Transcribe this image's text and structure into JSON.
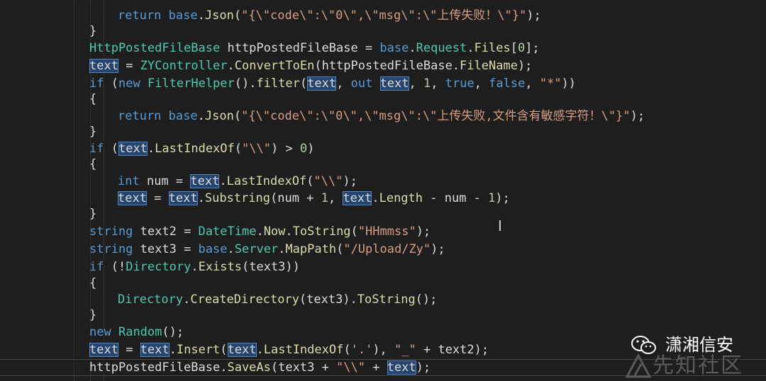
{
  "editor": {
    "lines": [
      [
        [
          "kw",
          "return"
        ],
        [
          "id",
          " "
        ],
        [
          "kw",
          "base"
        ],
        [
          "id",
          "."
        ],
        [
          "me",
          "Json"
        ],
        [
          "id",
          "("
        ],
        [
          "st",
          "\"{\\\"code\\\":\\\"0\\\",\\\"msg\\\":\\\"上传失败！\\\"}\""
        ],
        [
          "id",
          ");"
        ]
      ],
      [
        [
          "id",
          "}"
        ]
      ],
      [
        [
          "ty",
          "HttpPostedFileBase"
        ],
        [
          "id",
          " httpPostedFileBase = "
        ],
        [
          "kw",
          "base"
        ],
        [
          "id",
          "."
        ],
        [
          "ty",
          "Request"
        ],
        [
          "id",
          "."
        ],
        [
          "me",
          "Files"
        ],
        [
          "id",
          "["
        ],
        [
          "nu",
          "0"
        ],
        [
          "id",
          "];"
        ]
      ],
      [
        [
          "hl",
          "text"
        ],
        [
          "id",
          " = "
        ],
        [
          "ty",
          "ZYController"
        ],
        [
          "id",
          "."
        ],
        [
          "me",
          "ConvertToEn"
        ],
        [
          "id",
          "(httpPostedFileBase."
        ],
        [
          "me",
          "FileName"
        ],
        [
          "id",
          ");"
        ]
      ],
      [
        [
          "kw",
          "if"
        ],
        [
          "id",
          " ("
        ],
        [
          "kw",
          "new"
        ],
        [
          "id",
          " "
        ],
        [
          "ty",
          "FilterHelper"
        ],
        [
          "id",
          "()."
        ],
        [
          "me",
          "filter"
        ],
        [
          "id",
          "("
        ],
        [
          "hl",
          "text"
        ],
        [
          "id",
          ", "
        ],
        [
          "kw",
          "out"
        ],
        [
          "id",
          " "
        ],
        [
          "hl",
          "text"
        ],
        [
          "id",
          ", "
        ],
        [
          "nu",
          "1"
        ],
        [
          "id",
          ", "
        ],
        [
          "kw",
          "true"
        ],
        [
          "id",
          ", "
        ],
        [
          "kw",
          "false"
        ],
        [
          "id",
          ", "
        ],
        [
          "st",
          "\"*\""
        ],
        [
          "id",
          "))"
        ]
      ],
      [
        [
          "id",
          "{"
        ]
      ],
      [
        [
          "kw",
          "return"
        ],
        [
          "id",
          " "
        ],
        [
          "kw",
          "base"
        ],
        [
          "id",
          "."
        ],
        [
          "me",
          "Json"
        ],
        [
          "id",
          "("
        ],
        [
          "st",
          "\"{\\\"code\\\":\\\"0\\\",\\\"msg\\\":\\\"上传失败,文件含有敏感字符！\\\"}\""
        ],
        [
          "id",
          ");"
        ]
      ],
      [
        [
          "id",
          "}"
        ]
      ],
      [
        [
          "kw",
          "if"
        ],
        [
          "id",
          " ("
        ],
        [
          "hl",
          "text"
        ],
        [
          "id",
          "."
        ],
        [
          "me",
          "LastIndexOf"
        ],
        [
          "id",
          "("
        ],
        [
          "st",
          "\"\\\\\""
        ],
        [
          "id",
          ") > "
        ],
        [
          "nu",
          "0"
        ],
        [
          "id",
          ")"
        ]
      ],
      [
        [
          "id",
          "{"
        ]
      ],
      [
        [
          "kw",
          "int"
        ],
        [
          "id",
          " num = "
        ],
        [
          "hl",
          "text"
        ],
        [
          "id",
          "."
        ],
        [
          "me",
          "LastIndexOf"
        ],
        [
          "id",
          "("
        ],
        [
          "st",
          "\"\\\\\""
        ],
        [
          "id",
          ");"
        ]
      ],
      [
        [
          "hl",
          "text"
        ],
        [
          "id",
          " = "
        ],
        [
          "hl",
          "text"
        ],
        [
          "id",
          "."
        ],
        [
          "me",
          "Substring"
        ],
        [
          "id",
          "(num + "
        ],
        [
          "nu",
          "1"
        ],
        [
          "id",
          ", "
        ],
        [
          "hl",
          "text"
        ],
        [
          "id",
          "."
        ],
        [
          "me",
          "Length"
        ],
        [
          "id",
          " - num - "
        ],
        [
          "nu",
          "1"
        ],
        [
          "id",
          ");"
        ]
      ],
      [
        [
          "id",
          "}"
        ]
      ],
      [
        [
          "kw",
          "string"
        ],
        [
          "id",
          " text2 = "
        ],
        [
          "ty",
          "DateTime"
        ],
        [
          "id",
          "."
        ],
        [
          "me",
          "Now"
        ],
        [
          "id",
          "."
        ],
        [
          "me",
          "ToString"
        ],
        [
          "id",
          "("
        ],
        [
          "st",
          "\"HHmmss\""
        ],
        [
          "id",
          ");"
        ]
      ],
      [
        [
          "kw",
          "string"
        ],
        [
          "id",
          " text3 = "
        ],
        [
          "kw",
          "base"
        ],
        [
          "id",
          "."
        ],
        [
          "ty",
          "Server"
        ],
        [
          "id",
          "."
        ],
        [
          "me",
          "MapPath"
        ],
        [
          "id",
          "("
        ],
        [
          "st",
          "\"/Upload/Zy\""
        ],
        [
          "id",
          ");"
        ]
      ],
      [
        [
          "kw",
          "if"
        ],
        [
          "id",
          " (!"
        ],
        [
          "ty",
          "Directory"
        ],
        [
          "id",
          "."
        ],
        [
          "me",
          "Exists"
        ],
        [
          "id",
          "(text3))"
        ]
      ],
      [
        [
          "id",
          "{"
        ]
      ],
      [
        [
          "ty",
          "Directory"
        ],
        [
          "id",
          "."
        ],
        [
          "me",
          "CreateDirectory"
        ],
        [
          "id",
          "(text3)."
        ],
        [
          "me",
          "ToString"
        ],
        [
          "id",
          "();"
        ]
      ],
      [
        [
          "id",
          "}"
        ]
      ],
      [
        [
          "kw",
          "new"
        ],
        [
          "id",
          " "
        ],
        [
          "ty",
          "Random"
        ],
        [
          "id",
          "();"
        ]
      ],
      [
        [
          "hl",
          "text"
        ],
        [
          "id",
          " = "
        ],
        [
          "hl",
          "text"
        ],
        [
          "id",
          "."
        ],
        [
          "me",
          "Insert"
        ],
        [
          "id",
          "("
        ],
        [
          "hl",
          "text"
        ],
        [
          "id",
          "."
        ],
        [
          "me",
          "LastIndexOf"
        ],
        [
          "id",
          "("
        ],
        [
          "st",
          "'.'"
        ],
        [
          "id",
          "), "
        ],
        [
          "st",
          "\"_\""
        ],
        [
          "id",
          " + text2);"
        ]
      ],
      [
        [
          "id",
          "httpPostedFileBase."
        ],
        [
          "me",
          "SaveAs"
        ],
        [
          "id",
          "(text3 + "
        ],
        [
          "st",
          "\"\\\\\""
        ],
        [
          "id",
          " + "
        ],
        [
          "hl",
          "text"
        ],
        [
          "id",
          ");"
        ]
      ]
    ]
  },
  "watermark": {
    "account_name": "潇湘信安",
    "site_name": "先知社区"
  },
  "icons": {
    "cursor": "text-cursor-icon",
    "wechat": "wechat-logo-icon",
    "site": "xianzhi-logo-icon"
  },
  "colors": {
    "background": "#1e1e1e",
    "keyword": "#569cd6",
    "type": "#4ec9b0",
    "method": "#dcdcaa",
    "string": "#d69d85",
    "number": "#b5cea8",
    "highlight": "#26456e"
  }
}
